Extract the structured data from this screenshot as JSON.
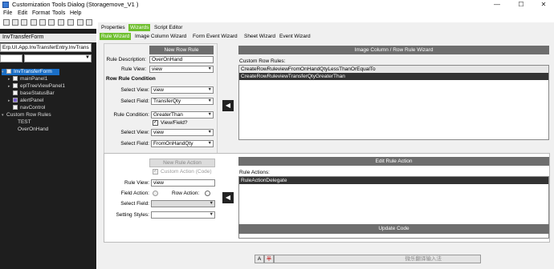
{
  "window": {
    "title": "Customization Tools Dialog  (Storagemove_V1 )",
    "minimize": "—",
    "maximize": "☐",
    "close": "✕"
  },
  "menu": [
    "File",
    "Edit",
    "Format",
    "Tools",
    "Help"
  ],
  "left_panel": {
    "header": "InvTransferForm",
    "path": "Erp.UI.App.InvTransferEntry.InvTrans",
    "tree": [
      {
        "label": "InvTransferForm",
        "level": 0,
        "selected": true
      },
      {
        "label": "mainPanel1",
        "level": 1
      },
      {
        "label": "eplTreeViewPanel1",
        "level": 1
      },
      {
        "label": "baseStatusBar",
        "level": 1
      },
      {
        "label": "alertPanel",
        "level": 1
      },
      {
        "label": "navControl",
        "level": 1
      },
      {
        "label": "Custom Row Rules",
        "level": 0
      },
      {
        "label": "TEST",
        "level": 1
      },
      {
        "label": "OverOnHand",
        "level": 1
      }
    ]
  },
  "tabs_top": {
    "properties": "Properties",
    "wizards": "Wizards",
    "script_editor": "Script Editor"
  },
  "tabs_wizard": {
    "rule_wizard": "Rule Wizard",
    "image_column_wizard": "Image Column Wizard",
    "form_event_wizard": "Form Event Wizard",
    "sheet_wizard": "Sheet Wizard",
    "event_wizard": "Event Wizard"
  },
  "rule": {
    "new_rule_button": "New Row Rule",
    "description_label": "Rule Description:",
    "description_value": "OverOnHand",
    "rule_view_label": "Rule View:",
    "rule_view_value": "view",
    "condition_header": "Row Rule Condition",
    "select_view_label": "Select View:",
    "select_view_value": "view",
    "select_field_label": "Select Field:",
    "select_field_value": "TransferQty",
    "rule_condition_label": "Rule Condition:",
    "rule_condition_value": "GreaterThan",
    "view_field_checkbox": "View/Field?",
    "select_view2_label": "Select View:",
    "select_view2_value": "view",
    "select_field2_label": "Select Field:",
    "select_field2_value": "FromOnHandQty"
  },
  "image_wizard": {
    "button": "Image Column / Row Rule Wizard",
    "custom_rules_label": "Custom Row Rules:",
    "custom_rules": [
      "CreateRowRuleviewFromOnHandQtyLessThanOrEqualTo",
      "CreateRowRuleviewTransferQtyGreaterThan"
    ]
  },
  "action": {
    "new_action_button": "New Rule Action",
    "custom_action_checkbox": "Custom Action (Code)",
    "rule_view_label": "Rule View:",
    "rule_view_value": "view",
    "field_action_label": "Field Action:",
    "row_action_label": "Row Action:",
    "select_field_label": "Select Field:",
    "setting_styles_label": "Setting Styles:",
    "edit_button": "Edit Rule Action",
    "rule_actions_label": "Rule Actions:",
    "rule_actions": [
      "RuleActionDelegate"
    ]
  },
  "update_button": "Update Code",
  "ime": {
    "mode1": "A",
    "mode2": "半",
    "input_hint": "微乐翻译输入法"
  },
  "arrow_glyph": "◀"
}
